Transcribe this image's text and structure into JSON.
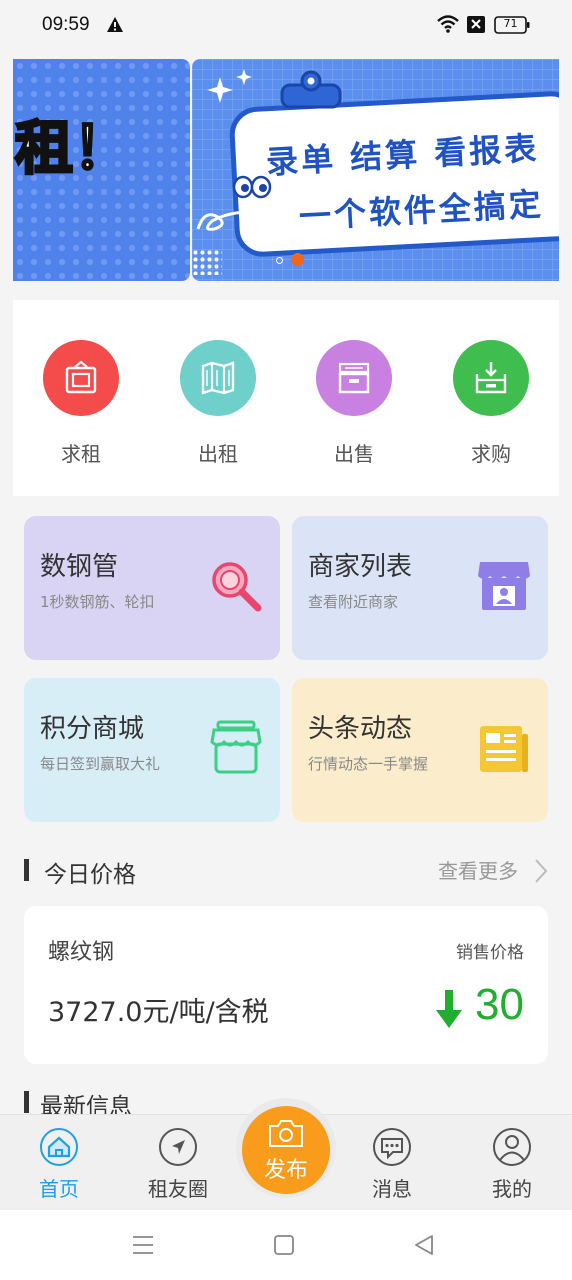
{
  "status_bar": {
    "time": "09:59",
    "battery": "71"
  },
  "banner": {
    "left_text": "租！",
    "line1": "录单 结算 看报表",
    "line2": "一个软件全搞定",
    "brand_color": "#2459c9",
    "active_indicator_color": "#f0651f"
  },
  "quick_actions": [
    {
      "label": "求租",
      "icon": "frame-icon",
      "color": "#f44b4b"
    },
    {
      "label": "出租",
      "icon": "map-icon",
      "color": "#6ecfcb"
    },
    {
      "label": "出售",
      "icon": "archive-box-icon",
      "color": "#c881e0"
    },
    {
      "label": "求购",
      "icon": "download-box-icon",
      "color": "#3fbd4e"
    }
  ],
  "features": [
    {
      "title": "数钢管",
      "subtitle": "1秒数钢筋、轮扣",
      "bg": "#d9d4f3",
      "icon": "magnifier-icon"
    },
    {
      "title": "商家列表",
      "subtitle": "查看附近商家",
      "bg": "#dbe3f7",
      "icon": "store-icon"
    },
    {
      "title": "积分商城",
      "subtitle": "每日签到赢取大礼",
      "bg": "#d7eef7",
      "icon": "shop-icon"
    },
    {
      "title": "头条动态",
      "subtitle": "行情动态一手掌握",
      "bg": "#fbedcc",
      "icon": "newspaper-icon"
    }
  ],
  "today_price": {
    "section_title": "今日价格",
    "more_label": "查看更多",
    "item_name": "螺纹钢",
    "price_label": "销售价格",
    "price_value": "3727.0元/吨/含税",
    "change": "30",
    "change_direction": "down",
    "change_color": "#1fae2e"
  },
  "latest_info": {
    "section_title": "最新信息"
  },
  "bottom_nav": {
    "items": [
      {
        "label": "首页",
        "icon": "home-icon",
        "active": true
      },
      {
        "label": "租友圈",
        "icon": "compass-icon",
        "active": false
      },
      {
        "label": "消息",
        "icon": "message-icon",
        "active": false
      },
      {
        "label": "我的",
        "icon": "profile-icon",
        "active": false
      }
    ],
    "publish_label": "发布",
    "publish_color": "#f99b1b",
    "active_color": "#1da0e6"
  }
}
